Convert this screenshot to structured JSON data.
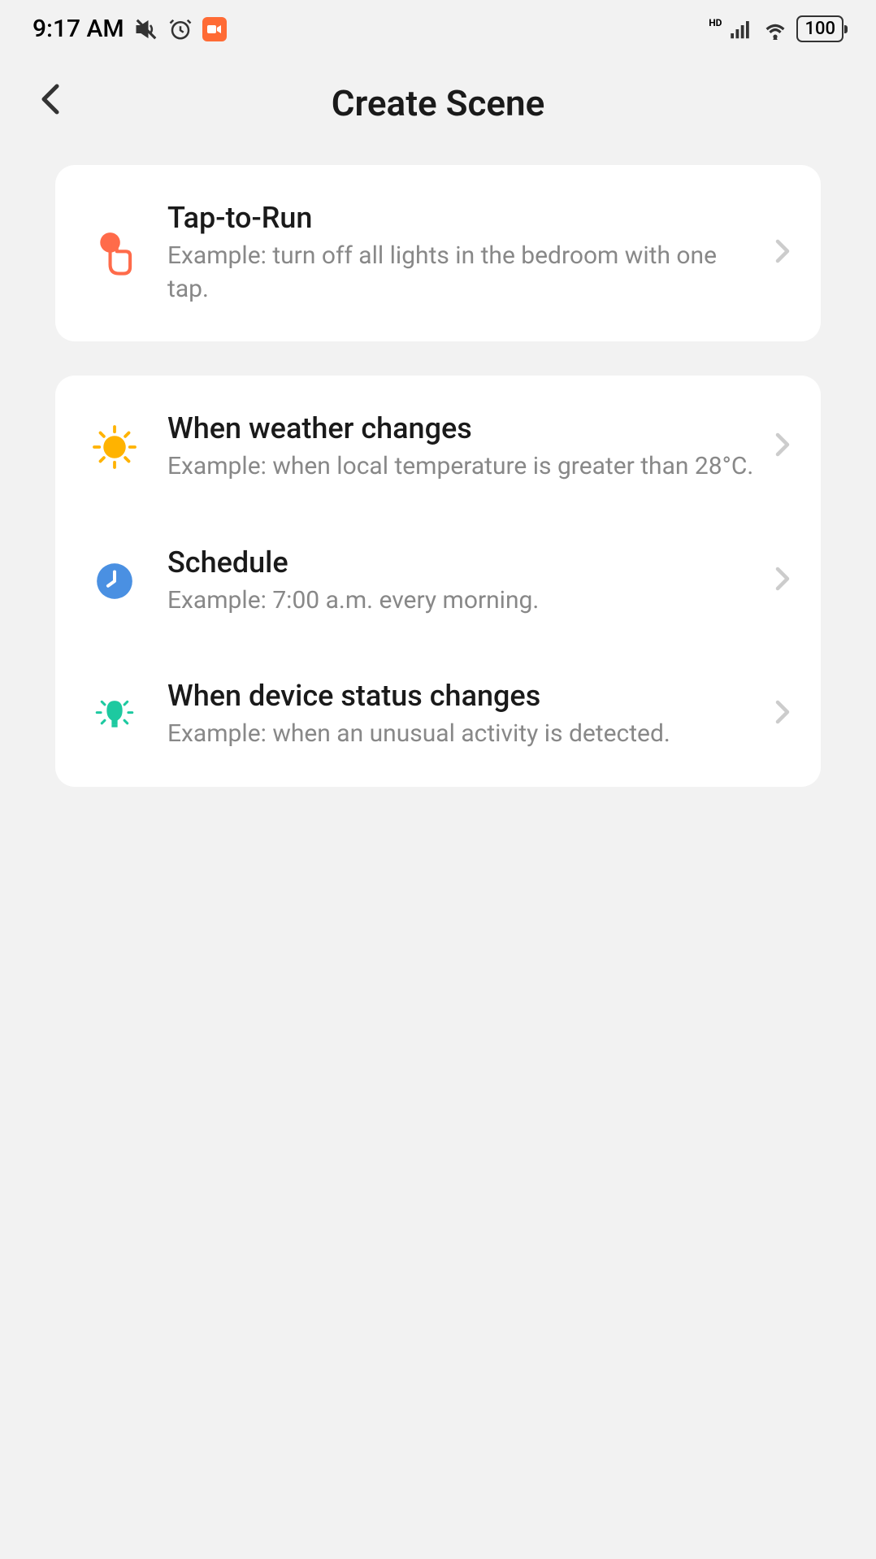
{
  "statusBar": {
    "time": "9:17 AM",
    "battery": "100",
    "hdLabel": "HD"
  },
  "header": {
    "title": "Create Scene"
  },
  "groups": [
    {
      "items": [
        {
          "icon": "tap",
          "title": "Tap-to-Run",
          "description": "Example: turn off all lights in the bedroom with one tap."
        }
      ]
    },
    {
      "items": [
        {
          "icon": "weather",
          "title": "When weather changes",
          "description": "Example: when local temperature is greater than 28°C."
        },
        {
          "icon": "schedule",
          "title": "Schedule",
          "description": "Example: 7:00 a.m. every morning."
        },
        {
          "icon": "device",
          "title": "When device status changes",
          "description": "Example: when an unusual activity is detected."
        }
      ]
    }
  ]
}
